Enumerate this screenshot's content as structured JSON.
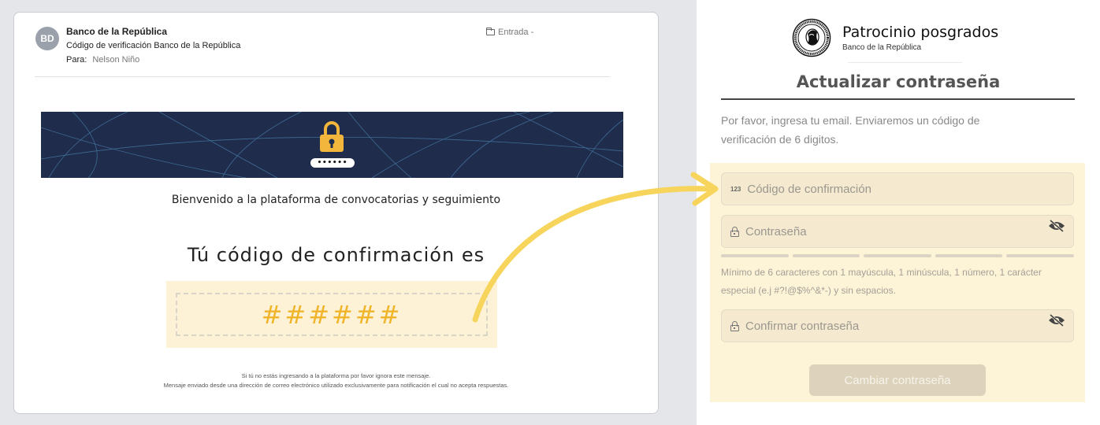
{
  "email": {
    "avatar_initials": "BD",
    "sender": "Banco de la República",
    "subject": "Código de verificación Banco de la República",
    "to_label": "Para:",
    "to_value": "Nelson Niño",
    "folder": "Entrada -",
    "banner_pin_mask": "••••••",
    "welcome": "Bienvenido a la plataforma de convocatorias y seguimiento",
    "code_heading": "Tú código de confirmación es",
    "code_value": "######",
    "footer_line1": "Si tú no estás ingresando a la plataforma por favor ignora este mensaje.",
    "footer_line2": "Mensaje enviado desde una dirección de correo electrónico utilizado exclusivamente para notificación el cual no acepta respuestas."
  },
  "form": {
    "brand_title": "Patrocinio posgrados",
    "brand_subtitle": "Banco de la República",
    "title": "Actualizar contraseña",
    "instructions": "Por favor, ingresa tu email. Enviaremos un código de verificación de 6 digitos.",
    "code_field": {
      "icon": "numeric-123-icon",
      "icon_text": "123",
      "placeholder": "Código de confirmación"
    },
    "password_field": {
      "icon": "lock-icon",
      "placeholder": "Contraseña"
    },
    "password_hint": "Mínimo de 6 caracteres con 1 mayúscula, 1 minúscula, 1 número, 1 carácter especial (e.j #?!@$%^&*-) y sin espacios.",
    "confirm_field": {
      "icon": "lock-icon",
      "placeholder": "Confirmar contraseña"
    },
    "submit_label": "Cambiar contraseña"
  },
  "colors": {
    "banner": "#1f2c4c",
    "accent_yellow": "#f0b429",
    "highlight_bg": "#fdf3d6",
    "arrow": "#f7d55c"
  }
}
